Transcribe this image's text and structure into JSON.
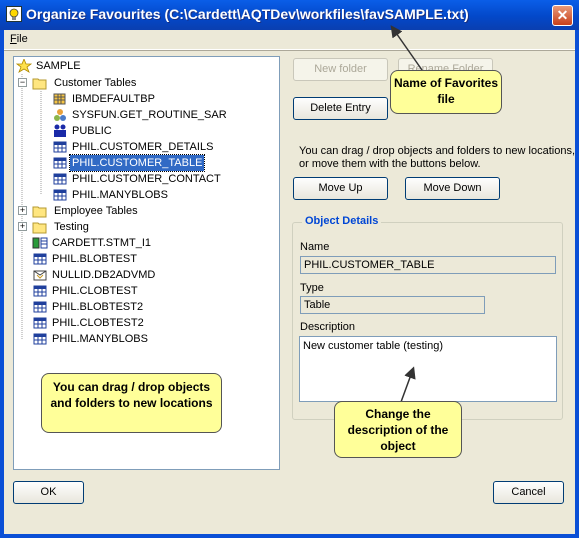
{
  "window": {
    "title": "Organize Favourites (C:\\Cardett\\AQTDev\\workfiles\\favSAMPLE.txt)",
    "close_glyph": "✕"
  },
  "menu": {
    "file_key": "F",
    "file_rest": "ile"
  },
  "tree": {
    "root": "SAMPLE",
    "customer_tables": "Customer Tables",
    "customer_items": [
      "IBMDEFAULTBP",
      "SYSFUN.GET_ROUTINE_SAR",
      "PUBLIC",
      "PHIL.CUSTOMER_DETAILS",
      "PHIL.CUSTOMER_TABLE",
      "PHIL.CUSTOMER_CONTACT",
      "PHIL.MANYBLOBS"
    ],
    "employee_tables": "Employee Tables",
    "testing": "Testing",
    "root_items": [
      "CARDETT.STMT_I1",
      "PHIL.BLOBTEST",
      "NULLID.DB2ADVMD",
      "PHIL.CLOBTEST",
      "PHIL.BLOBTEST2",
      "PHIL.CLOBTEST2",
      "PHIL.MANYBLOBS"
    ],
    "expand_plus": "+",
    "expand_minus": "−"
  },
  "buttons": {
    "new_folder": "New folder",
    "rename_folder": "Rename Folder",
    "delete_entry": "Delete Entry",
    "move_up": "Move Up",
    "move_down": "Move Down",
    "ok": "OK",
    "cancel": "Cancel"
  },
  "hint_text": "You can drag / drop objects and folders to new locations, or move them with the buttons below.",
  "details": {
    "group_title": "Object Details",
    "name_label": "Name",
    "name_value": "PHIL.CUSTOMER_TABLE",
    "type_label": "Type",
    "type_value": "Table",
    "description_label": "Description",
    "description_value": "New customer table (testing)"
  },
  "callouts": {
    "favorites_file": "Name of Favorites file",
    "drag_drop": "You can drag / drop objects and folders to new locations",
    "description": "Change the description of the object"
  },
  "colors": {
    "title_bar": "#0348c9",
    "selection": "#316ac5",
    "group_title": "#0046d5",
    "callout": "#ffff99"
  }
}
